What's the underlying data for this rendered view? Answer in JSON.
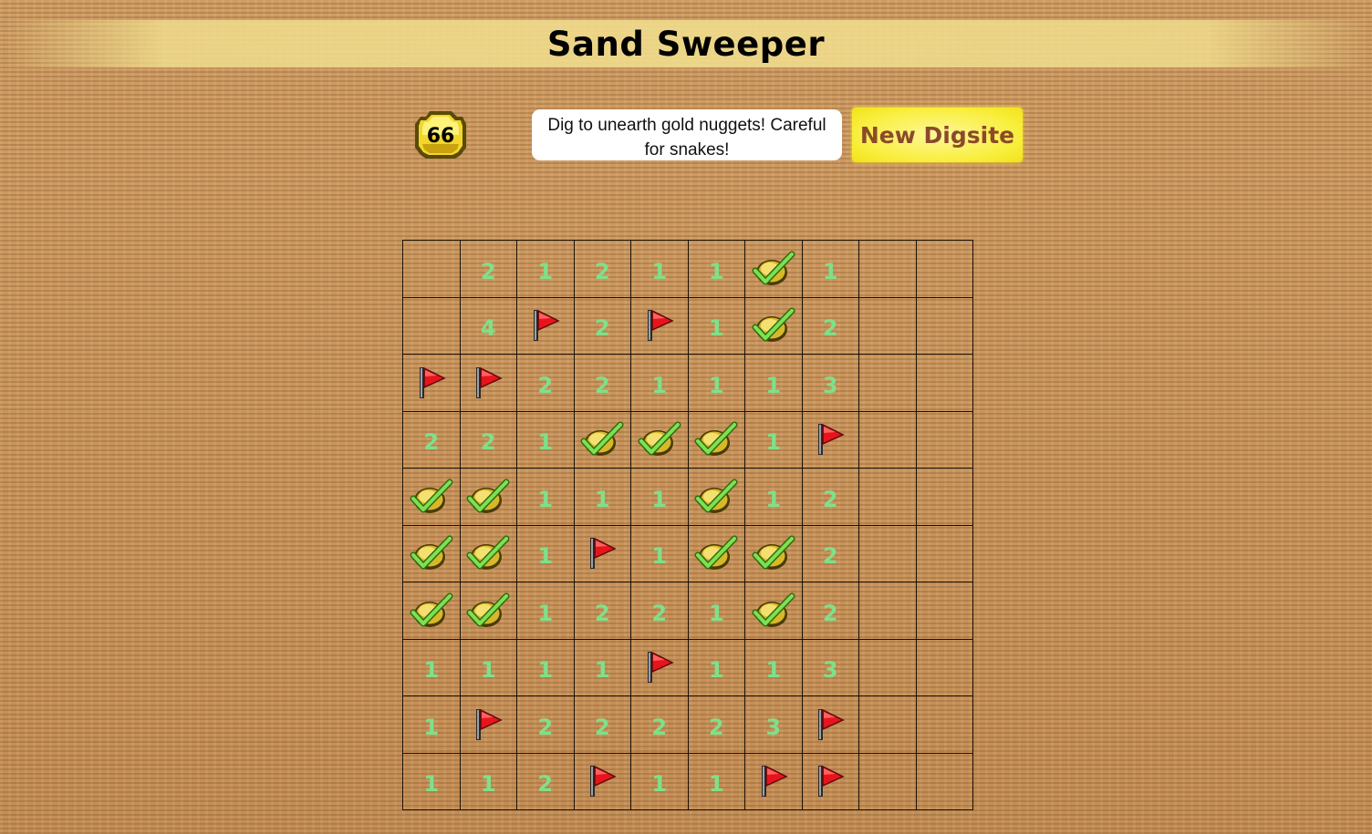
{
  "app": {
    "title": "Sand Sweeper"
  },
  "header": {
    "nugget_count": "66",
    "message": "Dig to unearth gold nuggets! Careful for snakes!",
    "new_game_label": "New Digsite"
  },
  "colors": {
    "number": "#7fe08a",
    "flag": "#e8141c",
    "nugget": "#f2d62a",
    "check": "#6ee04a",
    "button": "#f8ee3a",
    "button_text": "#8a4a2a"
  },
  "legend": {
    "F": "flag-icon",
    "G": "gold-nugget-check-icon",
    "": "empty-cell"
  },
  "grid": [
    [
      "",
      "2",
      "1",
      "2",
      "1",
      "1",
      "G",
      "1",
      "",
      ""
    ],
    [
      "",
      "4",
      "F",
      "2",
      "F",
      "1",
      "G",
      "2",
      "",
      ""
    ],
    [
      "F",
      "F",
      "2",
      "2",
      "1",
      "1",
      "1",
      "3",
      "",
      ""
    ],
    [
      "2",
      "2",
      "1",
      "G",
      "G",
      "G",
      "1",
      "F",
      "",
      ""
    ],
    [
      "G",
      "G",
      "1",
      "1",
      "1",
      "G",
      "1",
      "2",
      "",
      ""
    ],
    [
      "G",
      "G",
      "1",
      "F",
      "1",
      "G",
      "G",
      "2",
      "",
      ""
    ],
    [
      "G",
      "G",
      "1",
      "2",
      "2",
      "1",
      "G",
      "2",
      "",
      ""
    ],
    [
      "1",
      "1",
      "1",
      "1",
      "F",
      "1",
      "1",
      "3",
      "",
      ""
    ],
    [
      "1",
      "F",
      "2",
      "2",
      "2",
      "2",
      "3",
      "F",
      "",
      ""
    ],
    [
      "1",
      "1",
      "2",
      "F",
      "1",
      "1",
      "F",
      "F",
      "",
      ""
    ]
  ]
}
